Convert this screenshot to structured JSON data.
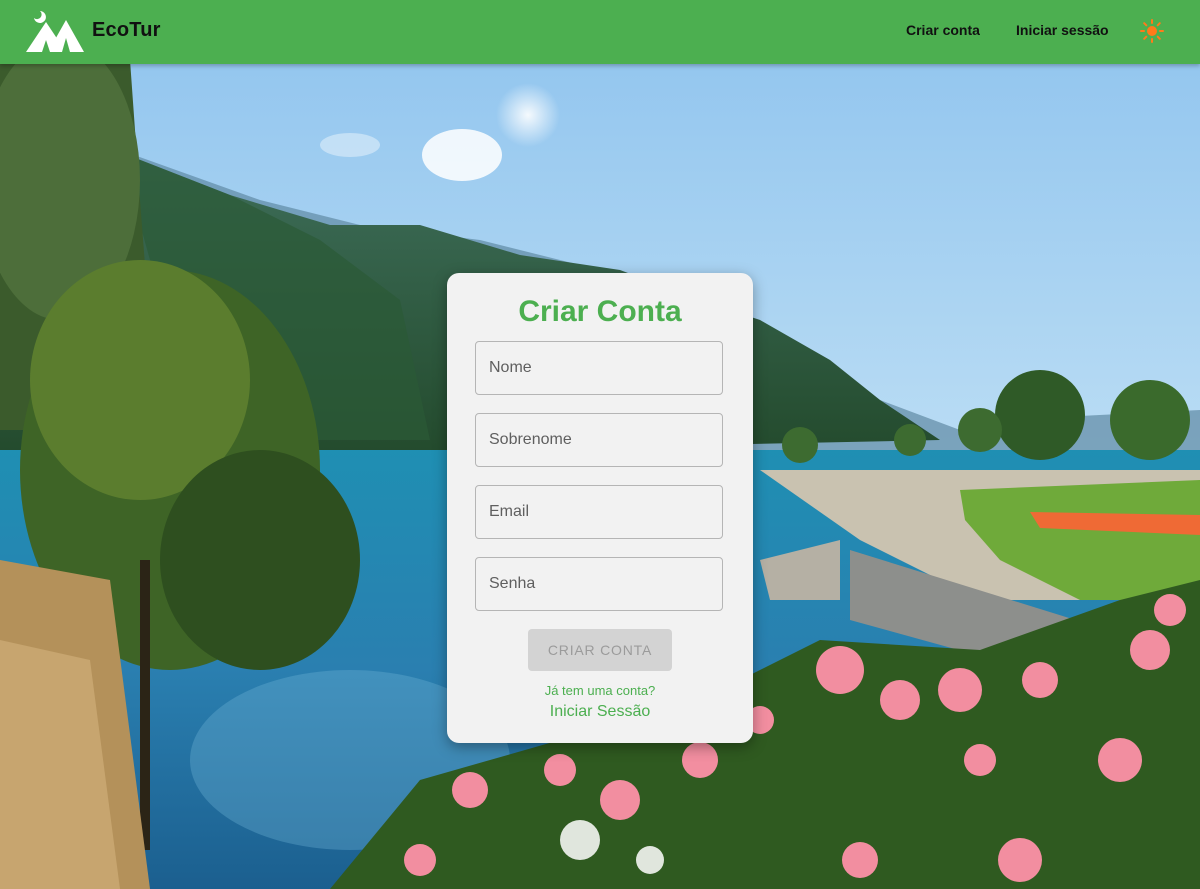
{
  "app": {
    "brand": "EcoTur"
  },
  "nav": {
    "create_account": "Criar conta",
    "login": "Iniciar sessão"
  },
  "icons": {
    "logo": "tent-moon-logo",
    "theme_toggle": "sun-icon"
  },
  "colors": {
    "primary": "#4caf50",
    "sun": "#ff7a1a",
    "card_bg": "#f2f2f2"
  },
  "form": {
    "title": "Criar Conta",
    "fields": [
      {
        "placeholder": "Nome",
        "value": ""
      },
      {
        "placeholder": "Sobrenome",
        "value": ""
      },
      {
        "placeholder": "Email",
        "value": ""
      },
      {
        "placeholder": "Senha",
        "value": ""
      }
    ],
    "submit_label": "CRIAR CONTA",
    "already_text": "Já tem uma conta?",
    "login_link": "Iniciar Sessão"
  }
}
